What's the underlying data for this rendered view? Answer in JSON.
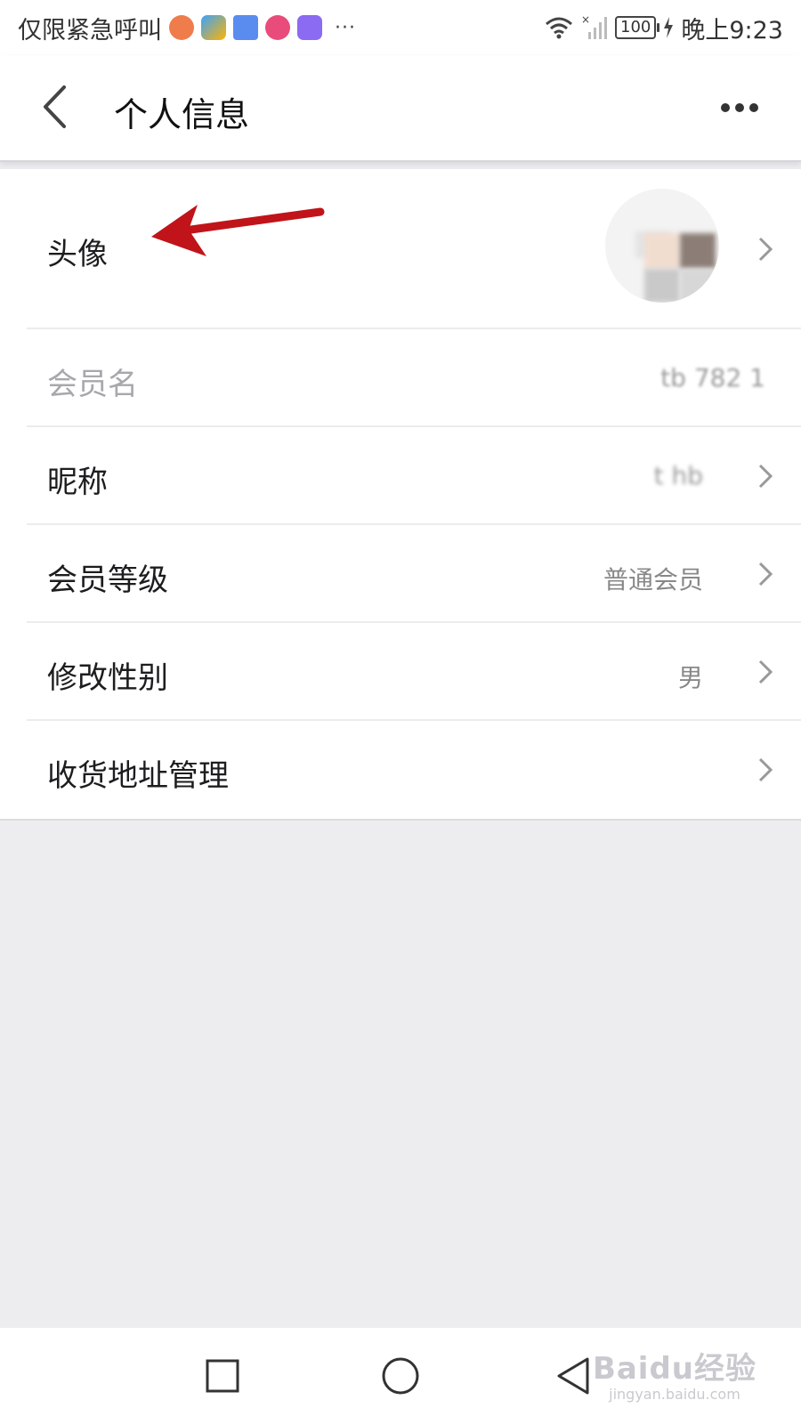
{
  "status_bar": {
    "left_text": "仅限紧急呼叫",
    "more": "···",
    "battery": "100",
    "time": "晚上9:23",
    "notification_icons": [
      "weibo-icon",
      "browser-icon",
      "calendar-icon",
      "music-icon",
      "clock-icon"
    ]
  },
  "header": {
    "title": "个人信息"
  },
  "rows": [
    {
      "label": "头像",
      "value": ""
    },
    {
      "label": "会员名",
      "value": "tb 782 1"
    },
    {
      "label": "昵称",
      "value": "t hb"
    },
    {
      "label": "会员等级",
      "value": "普通会员"
    },
    {
      "label": "修改性别",
      "value": "男"
    },
    {
      "label": "收货地址管理",
      "value": ""
    }
  ],
  "watermark": {
    "main": "Baidu经验",
    "sub": "jingyan.baidu.com"
  },
  "colors": {
    "background": "#ededf0",
    "annotation_arrow": "#c0141a"
  }
}
